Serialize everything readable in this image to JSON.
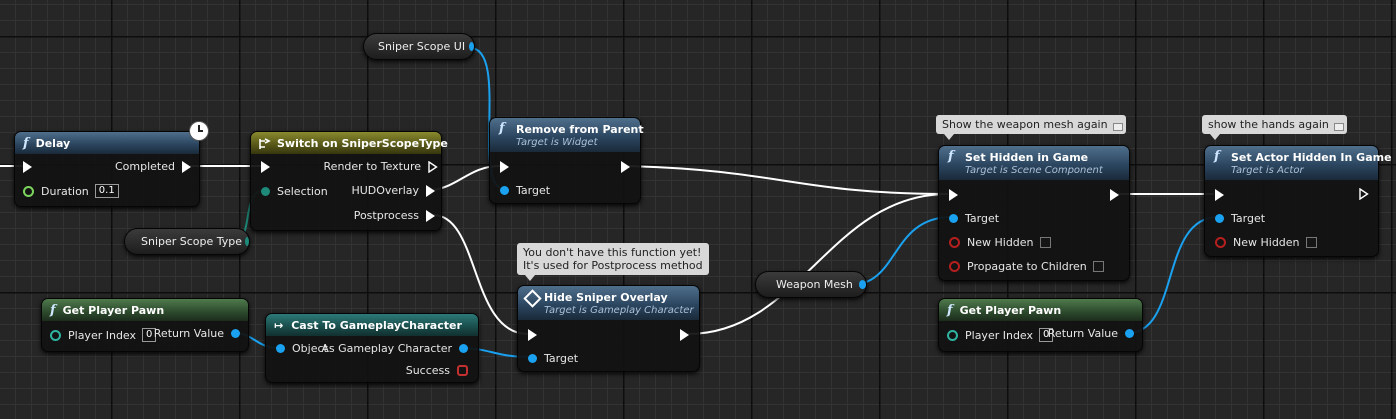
{
  "nodes": {
    "delay": {
      "title": "Delay",
      "completed": "Completed",
      "duration_label": "Duration",
      "duration_value": "0.1"
    },
    "switch": {
      "title": "Switch on SniperScopeType",
      "selection": "Selection",
      "render_to_texture": "Render to Texture",
      "hud_overlay": "HUDOverlay",
      "postprocess": "Postprocess"
    },
    "remove_from_parent": {
      "title": "Remove from Parent",
      "subtitle": "Target is Widget",
      "target": "Target"
    },
    "hide_sniper_overlay": {
      "title": "Hide Sniper Overlay",
      "subtitle": "Target is Gameplay Character",
      "target": "Target"
    },
    "get_player_pawn_left": {
      "title": "Get Player Pawn",
      "player_index_label": "Player Index",
      "player_index_value": "0",
      "return_value": "Return Value"
    },
    "cast": {
      "title": "Cast To GameplayCharacter",
      "object": "Object",
      "as_character": "As Gameplay Character",
      "success": "Success"
    },
    "set_hidden_in_game": {
      "title": "Set Hidden in Game",
      "subtitle": "Target is Scene Component",
      "target": "Target",
      "new_hidden": "New Hidden",
      "propagate": "Propagate to Children"
    },
    "get_player_pawn_right": {
      "title": "Get Player Pawn",
      "player_index_label": "Player Index",
      "player_index_value": "0",
      "return_value": "Return Value"
    },
    "set_actor_hidden": {
      "title": "Set Actor Hidden In Game",
      "subtitle": "Target is Actor",
      "target": "Target",
      "new_hidden": "New Hidden"
    }
  },
  "variables": {
    "sniper_scope_ui": "Sniper Scope UI",
    "sniper_scope_type": "Sniper Scope Type",
    "weapon_mesh": "Weapon Mesh"
  },
  "comments": {
    "hide_overlay_line1": "You don't have this function yet!",
    "hide_overlay_line2": "It's used for Postprocess method",
    "weapon_mesh": "Show the weapon mesh again",
    "hands": "show the hands again"
  },
  "colors": {
    "exec_wire": "#ffffff",
    "object_wire": "#1aa1f0",
    "enum_wire": "#1d8a7a",
    "function_header": "#2c4660",
    "pure_header": "#2f4d2f",
    "cast_header": "#1a4f4d",
    "switch_header": "#5a5a1a"
  },
  "icons": {
    "function": "function-f-icon",
    "delay": "clock-icon",
    "switch": "switch-icon",
    "cast": "cast-arrow-icon",
    "hide_overlay": "diamond-icon"
  }
}
